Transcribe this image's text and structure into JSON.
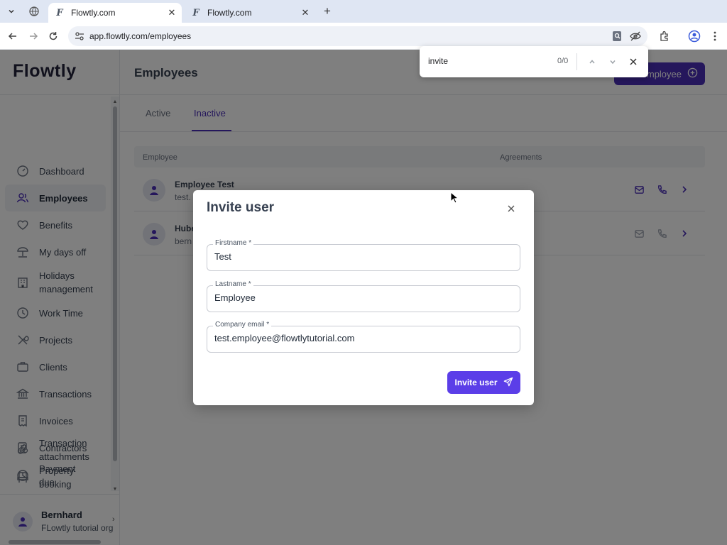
{
  "browser": {
    "tabs": [
      {
        "title": "Flowtly.com",
        "favicon": "F",
        "active": true
      },
      {
        "title": "Flowtly.com",
        "favicon": "F",
        "active": false
      }
    ],
    "url": "app.flowtly.com/employees"
  },
  "find_bar": {
    "query": "invite",
    "count": "0/0"
  },
  "app": {
    "logo": "Flowtly",
    "sidebar": {
      "items": [
        {
          "label": "Dashboard",
          "icon": "dashboard-icon"
        },
        {
          "label": "Employees",
          "icon": "users-icon",
          "active": true
        },
        {
          "label": "Benefits",
          "icon": "heart-icon"
        },
        {
          "label": "My days off",
          "icon": "beach-icon"
        },
        {
          "label": "Holidays management",
          "icon": "building-icon"
        },
        {
          "label": "Work Time",
          "icon": "clock-icon"
        },
        {
          "label": "Projects",
          "icon": "tools-icon"
        },
        {
          "label": "Clients",
          "icon": "briefcase-icon"
        },
        {
          "label": "Transactions",
          "icon": "bank-icon"
        },
        {
          "label": "Invoices",
          "icon": "invoice-icon"
        },
        {
          "label": "Contractors",
          "icon": "contract-icon"
        },
        {
          "label": "Payment due",
          "icon": "clock-icon"
        },
        {
          "label": "Transaction attachments",
          "icon": "paperclip-icon"
        },
        {
          "label": "Property booking",
          "icon": "chair-icon"
        }
      ],
      "user": {
        "name": "Bernhard",
        "org": "FLowtly tutorial org"
      }
    },
    "page_title": "Employees",
    "add_button": "mployee",
    "page_tabs": [
      {
        "label": "Active"
      },
      {
        "label": "Inactive",
        "selected": true
      }
    ],
    "table": {
      "headers": {
        "employee": "Employee",
        "agreements": "Agreements"
      },
      "rows": [
        {
          "name": "Employee Test",
          "email": "test."
        },
        {
          "name": "Hube",
          "email": "bern"
        }
      ]
    }
  },
  "modal": {
    "title": "Invite user",
    "fields": [
      {
        "label": "Firstname *",
        "value": "Test"
      },
      {
        "label": "Lastname *",
        "value": "Employee"
      },
      {
        "label": "Company email *",
        "value": "test.employee@flowtlytutorial.com"
      }
    ],
    "submit_label": "Invite user"
  },
  "colors": {
    "accent": "#5b3ee8",
    "primary_dark": "#4a2fb8"
  }
}
